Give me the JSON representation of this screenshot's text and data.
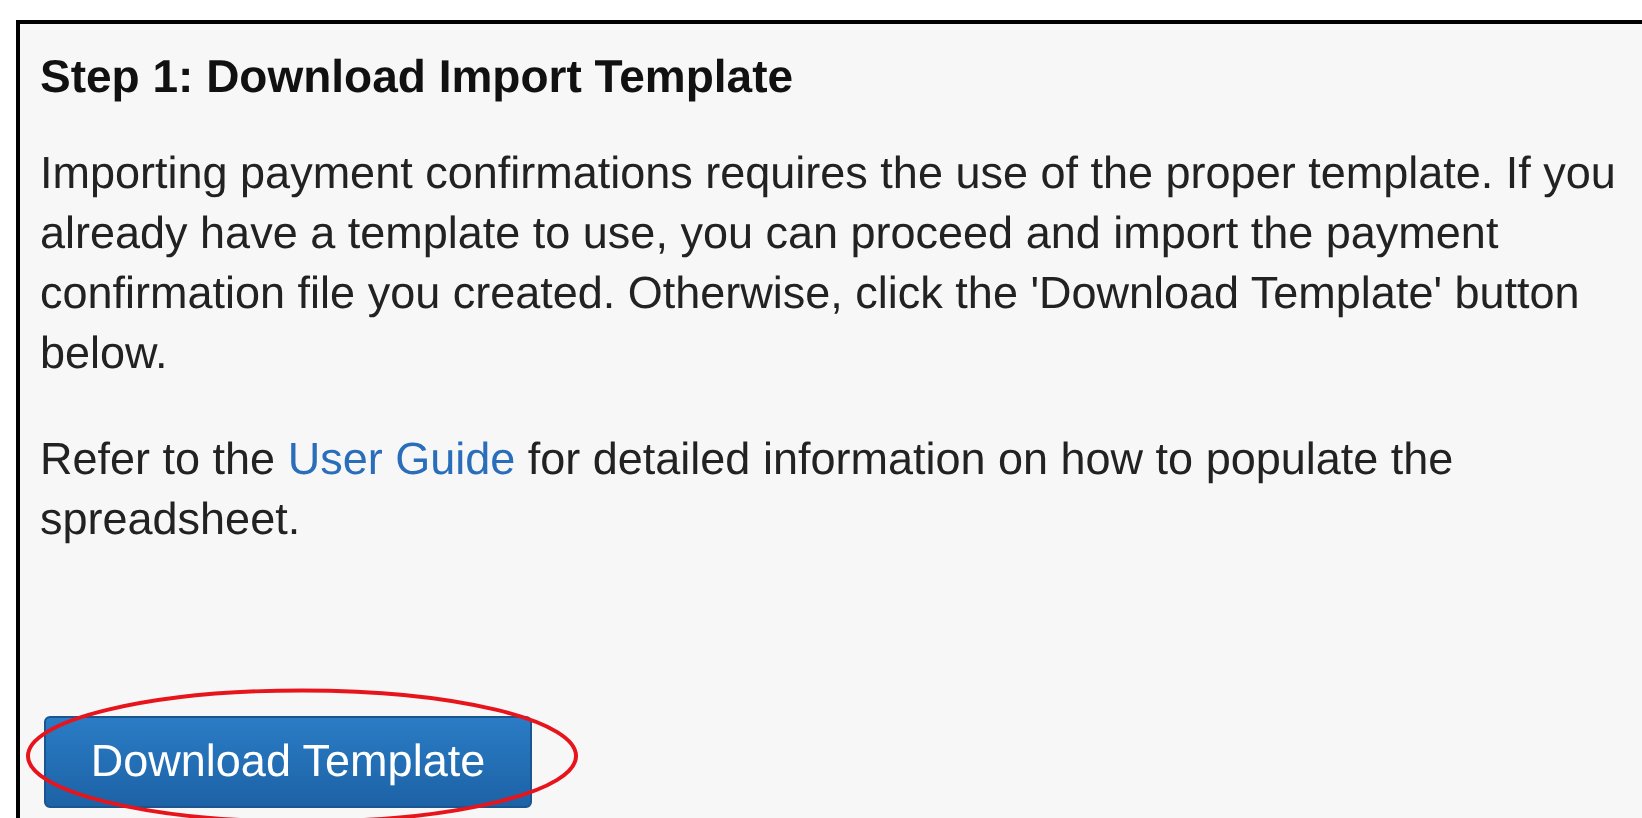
{
  "panel": {
    "heading": "Step 1: Download Import Template",
    "paragraphs": [
      {
        "text": "Importing payment confirmations requires the use of the proper template. If you already have a template to use, you can proceed and import the payment confirmation file you created. Otherwise, click the 'Download Template' button below."
      },
      {
        "text": "Refer to the ",
        "link": "User Guide",
        "after": " for detailed information on how to populate the spreadsheet."
      }
    ],
    "button": {
      "label": "Download Template",
      "highlighted": true
    }
  }
}
